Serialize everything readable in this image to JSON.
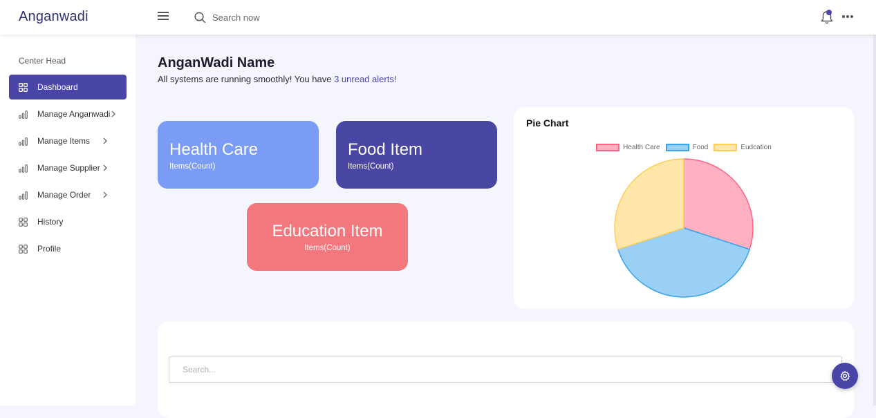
{
  "header": {
    "brand": "Anganwadi",
    "search_placeholder": "Search now",
    "icons": [
      "menu-icon",
      "search-icon",
      "bell-icon",
      "more-icon"
    ]
  },
  "sidebar": {
    "section_title": "Center Head",
    "items": [
      {
        "label": "Dashboard",
        "icon": "grid-icon",
        "active": true
      },
      {
        "label": "Manage Anganwadi",
        "icon": "bar-chart-icon",
        "chevron": true
      },
      {
        "label": "Manage Items",
        "icon": "bar-chart-icon",
        "chevron": true
      },
      {
        "label": "Manage Supplier",
        "icon": "bar-chart-icon",
        "chevron": true
      },
      {
        "label": "Manage Order",
        "icon": "bar-chart-icon",
        "chevron": true
      },
      {
        "label": "History",
        "icon": "grid-icon"
      },
      {
        "label": "Profile",
        "icon": "grid-icon"
      }
    ]
  },
  "main": {
    "title": "AnganWadi Name",
    "subtitle_prefix": "All systems are running smoothly! You have ",
    "subtitle_alerts": "3 unread alerts!",
    "cards": [
      {
        "title": "Health Care",
        "subtitle": "Items(Count)",
        "color": "#7b9cf5"
      },
      {
        "title": "Food Item",
        "subtitle": "Items(Count)",
        "color": "#4a46a4"
      },
      {
        "title": "Education Item",
        "subtitle": "Items(Count)",
        "color": "#f2787d"
      }
    ],
    "table_search_placeholder": "Search..."
  },
  "chart_data": {
    "type": "pie",
    "title": "Pie Chart",
    "legend_position": "top",
    "categories": [
      "Health Care",
      "Food",
      "Eudcation"
    ],
    "values": [
      30,
      40,
      30
    ],
    "colors": [
      "#ffb0c1",
      "#9ad0f5",
      "#ffe6aa"
    ],
    "border_colors": [
      "#ff6384",
      "#36a2eb",
      "#ffcd56"
    ]
  },
  "colors": {
    "accent": "#4a46a8",
    "background": "#f4f5fd"
  }
}
